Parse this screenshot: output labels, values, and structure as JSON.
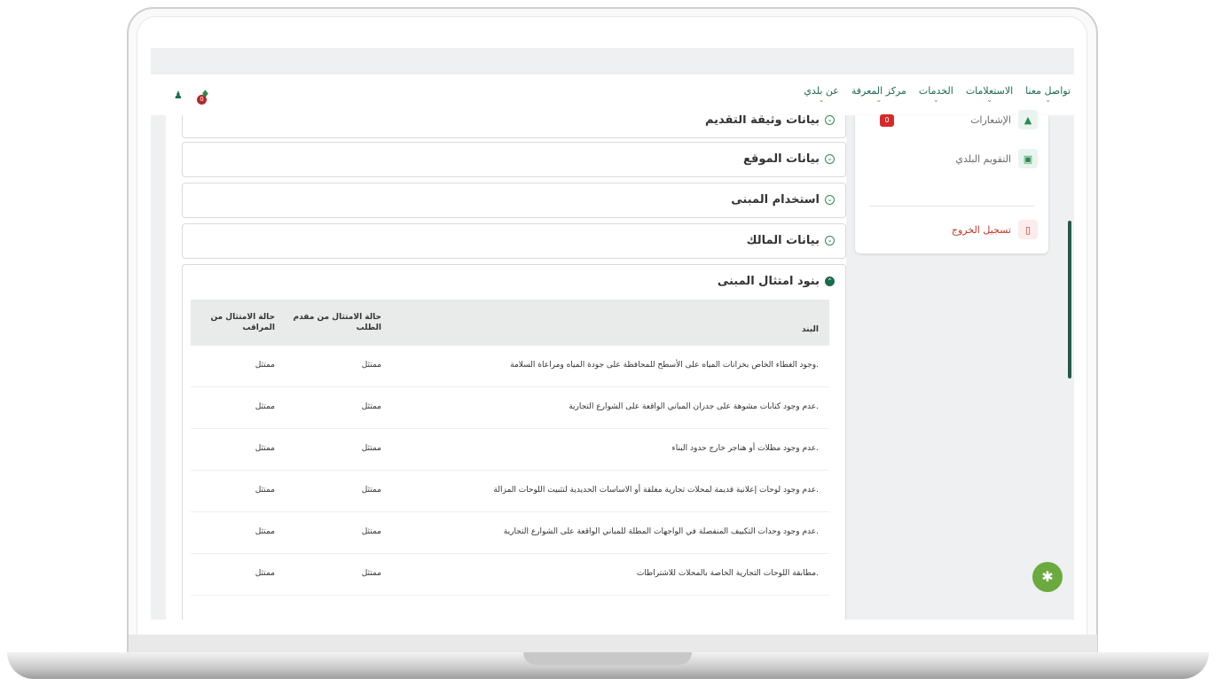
{
  "nav": [
    "عن بلدي",
    "مركز المعرفة",
    "الخدمات",
    "الاستعلامات",
    "تواصل معنا"
  ],
  "header": {
    "notification_count": "0",
    "user_icon": "user-icon",
    "bell_icon": "bell-icon"
  },
  "sidebar": {
    "notifications": {
      "label": "الإشعارات",
      "badge": "0"
    },
    "calendar": {
      "label": "التقويم البلدي"
    },
    "logout": {
      "label": "تسجيل الخروج"
    }
  },
  "panels": [
    "بيانات وثيقة التقديم",
    "بيانات الموقع",
    "استخدام المبنى",
    "بيانات المالك"
  ],
  "compliance": {
    "title": "بنود امتثال المبنى",
    "columns": {
      "item": "البند",
      "applicant": "حالة الامتثال من مقدم الطلب",
      "inspector": "حالة الامتثال من المراقب"
    },
    "rows": [
      {
        "item": "وجود الغطاء الخاص بخزانات المياه على الأسطح للمحافظة على جودة المياه ومراعاة السلامة.",
        "applicant": "ممتثل",
        "inspector": "ممتثل"
      },
      {
        "item": "عدم وجود كتابات مشوهة على جدران المباني الواقعة على الشوارع التجارية.",
        "applicant": "ممتثل",
        "inspector": "ممتثل"
      },
      {
        "item": "عدم وجود مظلات أو هناجر خارج حدود البناء.",
        "applicant": "ممتثل",
        "inspector": "ممتثل"
      },
      {
        "item": "عدم وجود لوحات إعلانية قديمة لمحلات تجارية مغلقة أو الاساسات الحديدية لتثبيت اللوحات المزالة.",
        "applicant": "ممتثل",
        "inspector": "ممتثل"
      },
      {
        "item": "عدم وجود وحدات التكييف المنفصلة في الواجهات المطلة للمباني الواقعة على الشوارع التجارية.",
        "applicant": "ممتثل",
        "inspector": "ممتثل"
      },
      {
        "item": "مطابقة اللوحات التجارية الخاصة بالمحلات للاشتراطات.",
        "applicant": "ممتثل",
        "inspector": "ممتثل"
      }
    ]
  }
}
